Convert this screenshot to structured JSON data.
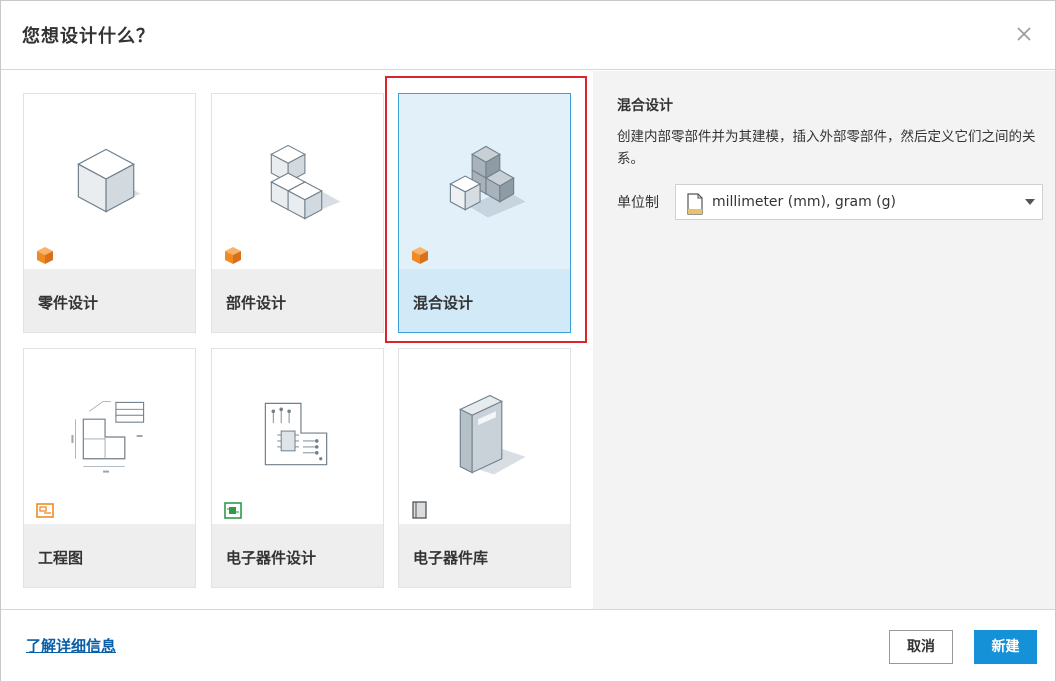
{
  "dialog": {
    "title": "您想设计什么？",
    "close_icon": "close-icon"
  },
  "tiles": [
    {
      "label": "零件设计",
      "icon": "cube-icon",
      "badge_icon": "orange-cube-badge-icon",
      "selected": false
    },
    {
      "label": "部件设计",
      "icon": "stacked-cubes-icon",
      "badge_icon": "orange-cube-badge-icon",
      "selected": false
    },
    {
      "label": "混合设计",
      "icon": "mixed-cubes-icon",
      "badge_icon": "orange-cube-badge-icon",
      "selected": true
    },
    {
      "label": "工程图",
      "icon": "drawing-icon",
      "badge_icon": "drawing-badge-icon",
      "selected": false
    },
    {
      "label": "电子器件设计",
      "icon": "circuit-board-icon",
      "badge_icon": "electronics-badge-icon",
      "selected": false
    },
    {
      "label": "电子器件库",
      "icon": "library-book-icon",
      "badge_icon": "book-badge-icon",
      "selected": false
    }
  ],
  "details": {
    "title": "混合设计",
    "description": "创建内部零部件并为其建模，插入外部零部件，然后定义它们之间的关系。",
    "unit_label": "单位制",
    "unit_value": "millimeter (mm), gram (g)"
  },
  "footer": {
    "learn_more": "了解详细信息",
    "cancel_label": "取消",
    "create_label": "新建"
  },
  "colors": {
    "accent": "#1591d8",
    "selection_outline": "#d9252b",
    "selected_tile_bg": "#e1f0f9",
    "badge_orange": "#f08a24"
  }
}
